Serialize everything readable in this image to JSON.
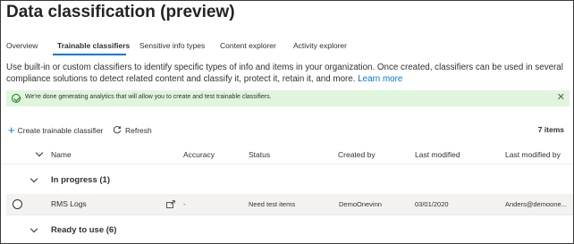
{
  "page": {
    "title": "Data classification (preview)"
  },
  "tabs": [
    {
      "label": "Overview",
      "active": false
    },
    {
      "label": "Trainable classifiers",
      "active": true
    },
    {
      "label": "Sensitive info types",
      "active": false
    },
    {
      "label": "Content explorer",
      "active": false
    },
    {
      "label": "Activity explorer",
      "active": false
    }
  ],
  "description": {
    "text": "Use built-in or custom classifiers to identify specific types of info and items in your organization. Once created, classifiers can be used in several compliance solutions to detect related content and classify it, protect it, retain it, and more.",
    "link": "Learn more"
  },
  "banner": {
    "text": "We're done generating analytics that will allow you to create and test trainable classifiers.",
    "close": "✕",
    "color": "#dff6dd"
  },
  "toolbar": {
    "create_label": "Create trainable classifier",
    "refresh_label": "Refresh",
    "item_count": "7 items"
  },
  "table": {
    "columns": [
      "Name",
      "Accuracy",
      "Status",
      "Created by",
      "Last modified",
      "Last modified by"
    ],
    "groups": [
      {
        "label": "In progress (1)",
        "rows": [
          {
            "name": "RMS Logs",
            "accuracy": "-",
            "status": "Need test items",
            "created_by": "DemoOnevinn",
            "last_modified": "03/01/2020",
            "last_modified_by": "Anders@demoone..."
          }
        ]
      },
      {
        "label": "Ready to use (6)",
        "rows": []
      }
    ]
  },
  "colors": {
    "accent": "#0078d4",
    "selected_row": "#f3f2f1"
  }
}
